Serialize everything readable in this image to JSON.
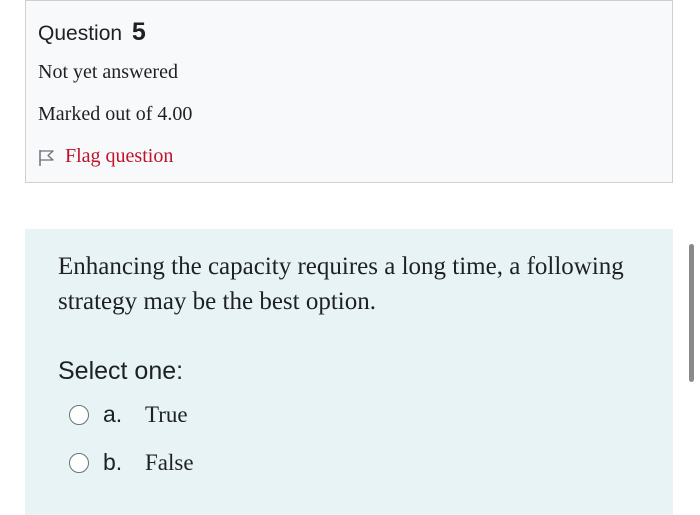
{
  "question": {
    "label": "Question",
    "number": "5",
    "state": "Not yet answered",
    "grade": "Marked out of 4.00",
    "flag_label": "Flag question"
  },
  "content": {
    "text": "Enhancing the capacity requires a long time, a following strategy may be the best option.",
    "prompt": "Select one:",
    "options": [
      {
        "letter": "a.",
        "text": "True",
        "selected": false
      },
      {
        "letter": "b.",
        "text": "False",
        "selected": false
      }
    ]
  },
  "colors": {
    "info_background": "#f8f9fa",
    "content_background": "#e7f3f5",
    "flag_text": "#c1112c"
  },
  "icons": {
    "flag": "flag-outline-icon",
    "radio": "radio-unchecked-icon"
  }
}
